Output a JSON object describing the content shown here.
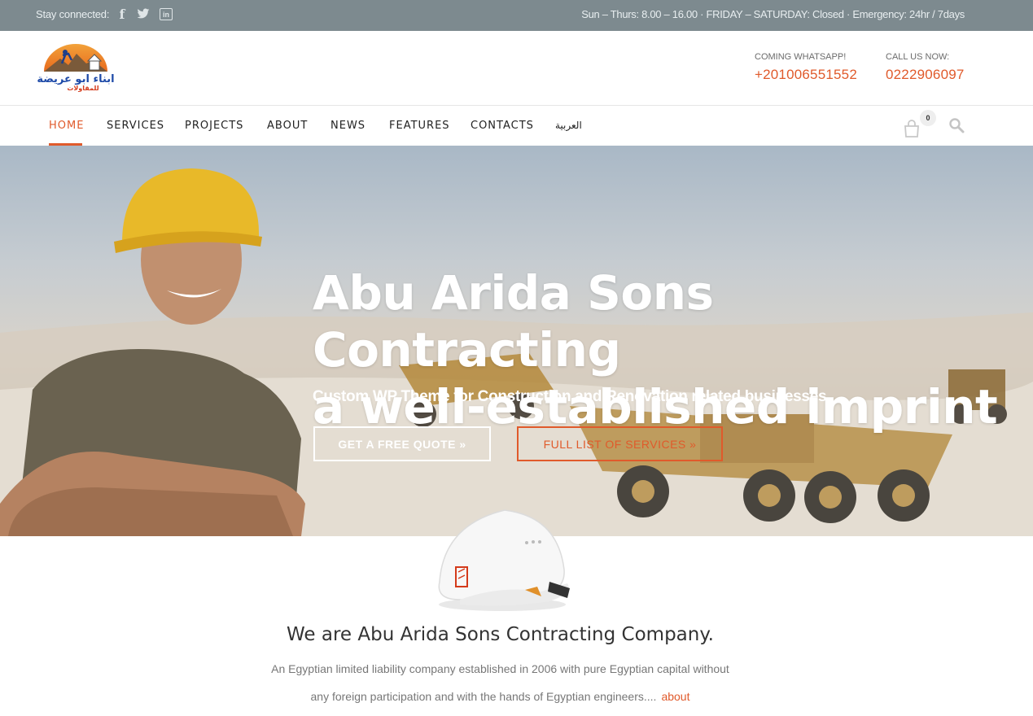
{
  "topbar": {
    "stay_connected": "Stay connected:",
    "hours": "Sun – Thurs: 8.00 – 16.00 · FRIDAY – SATURDAY: Closed · Emergency: 24hr / 7days",
    "social": [
      "facebook-icon",
      "twitter-icon",
      "linkedin-icon"
    ]
  },
  "header": {
    "whatsapp_label": "COMING WHATSAPP!",
    "whatsapp_number": "+201006551552",
    "call_label": "CALL US NOW:",
    "call_number": "0222906097"
  },
  "nav": {
    "items": [
      "HOME",
      "SERVICES",
      "PROJECTS",
      "ABOUT",
      "NEWS",
      "FEATURES",
      "CONTACTS",
      "العربية"
    ],
    "active": "HOME",
    "cart_count": "0"
  },
  "hero": {
    "title_line1": "Abu Arida Sons Contracting",
    "title_line2": "a well-established imprint",
    "subtitle": "Custom WP Theme for Construction and Renovation related businesses",
    "btn_quote": "GET A FREE QUOTE »",
    "btn_services": "FULL LIST OF SERVICES »"
  },
  "intro": {
    "title": "We are Abu Arida Sons Contracting Company.",
    "line1": "An Egyptian limited liability company established in 2006 with pure Egyptian capital without",
    "line2": "any foreign participation and with the hands of Egyptian engineers....",
    "more_link": "about"
  },
  "colors": {
    "accent": "#e05a2b",
    "topbar": "#7d8a8f"
  }
}
